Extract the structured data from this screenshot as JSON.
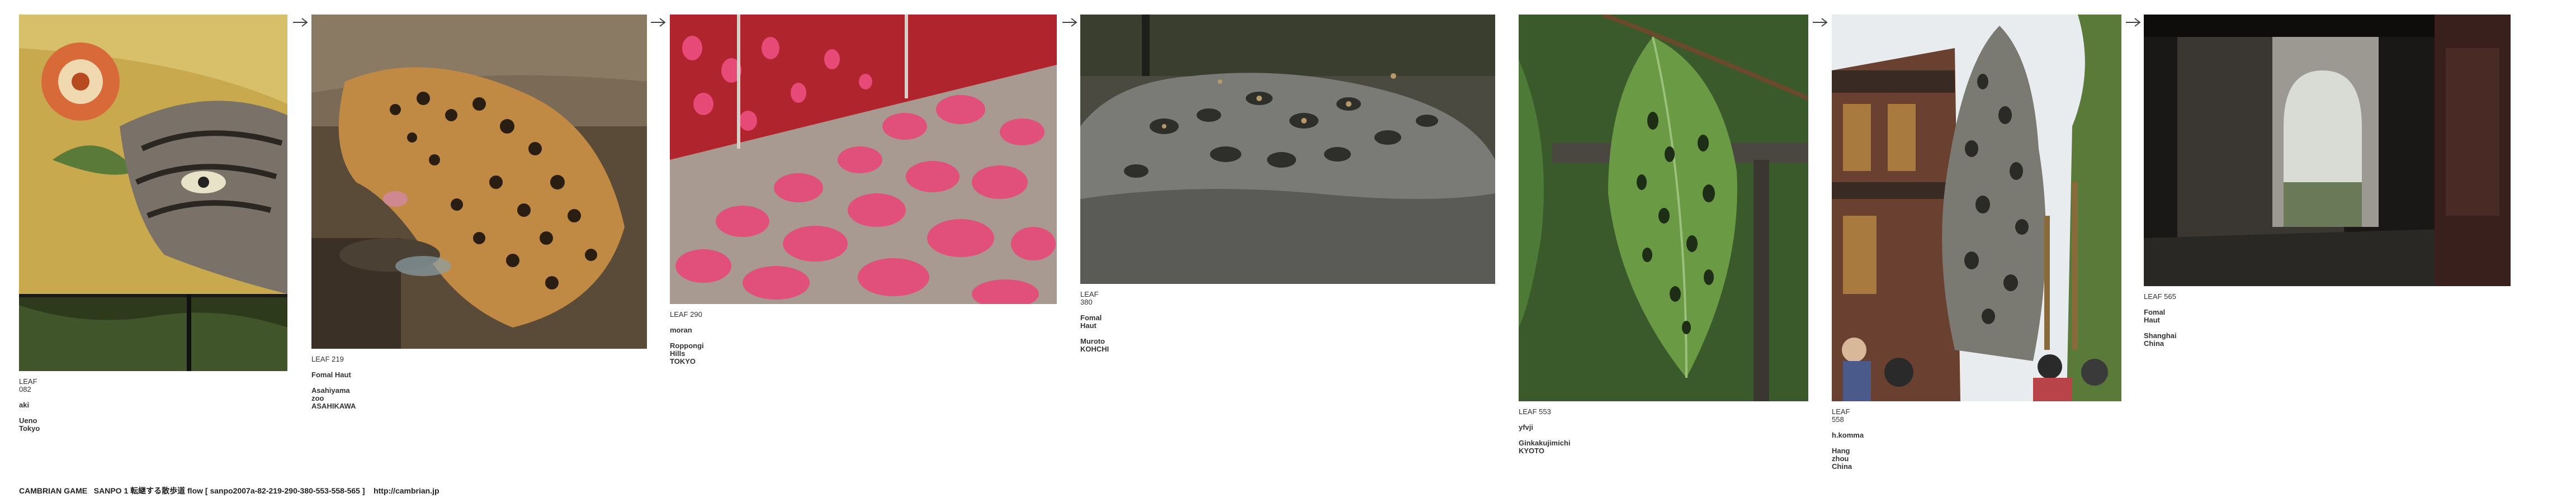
{
  "leaves": [
    {
      "id": "LEAF 082",
      "author": "aki",
      "place": "Ueno Tokyo",
      "subject": "painted tiger folding screen"
    },
    {
      "id": "LEAF 219",
      "author": "Fomal Haut",
      "place": "Asahiyama zoo ASAHIKAWA",
      "subject": "leopard drinking water"
    },
    {
      "id": "LEAF 290",
      "author": "moran",
      "place": "Roppongi Hills TOKYO",
      "subject": "pink polka dot floor"
    },
    {
      "id": "LEAF 380",
      "author": "Fomal Haut",
      "place": "Muroto KOHCHI",
      "subject": "pitted stone with coins"
    },
    {
      "id": "LEAF 553",
      "author": "yfvji",
      "place": "Ginkakujimichi KYOTO",
      "subject": "leaf with holes"
    },
    {
      "id": "LEAF 558",
      "author": "h.komma",
      "place": "Hang zhou  China",
      "subject": "porous scholar rock"
    },
    {
      "id": "LEAF 565",
      "author": "Fomal Haut",
      "place": "Shanghai China",
      "subject": "garden moon gate doorway"
    }
  ],
  "arrow_icon": "right-arrow-icon",
  "footer": {
    "text": "CAMBRIAN GAME   SANPO 1 転継する散歩道 flow [ sanpo2007a-82-219-290-380-553-558-565 ]    http://cambrian.jp"
  }
}
